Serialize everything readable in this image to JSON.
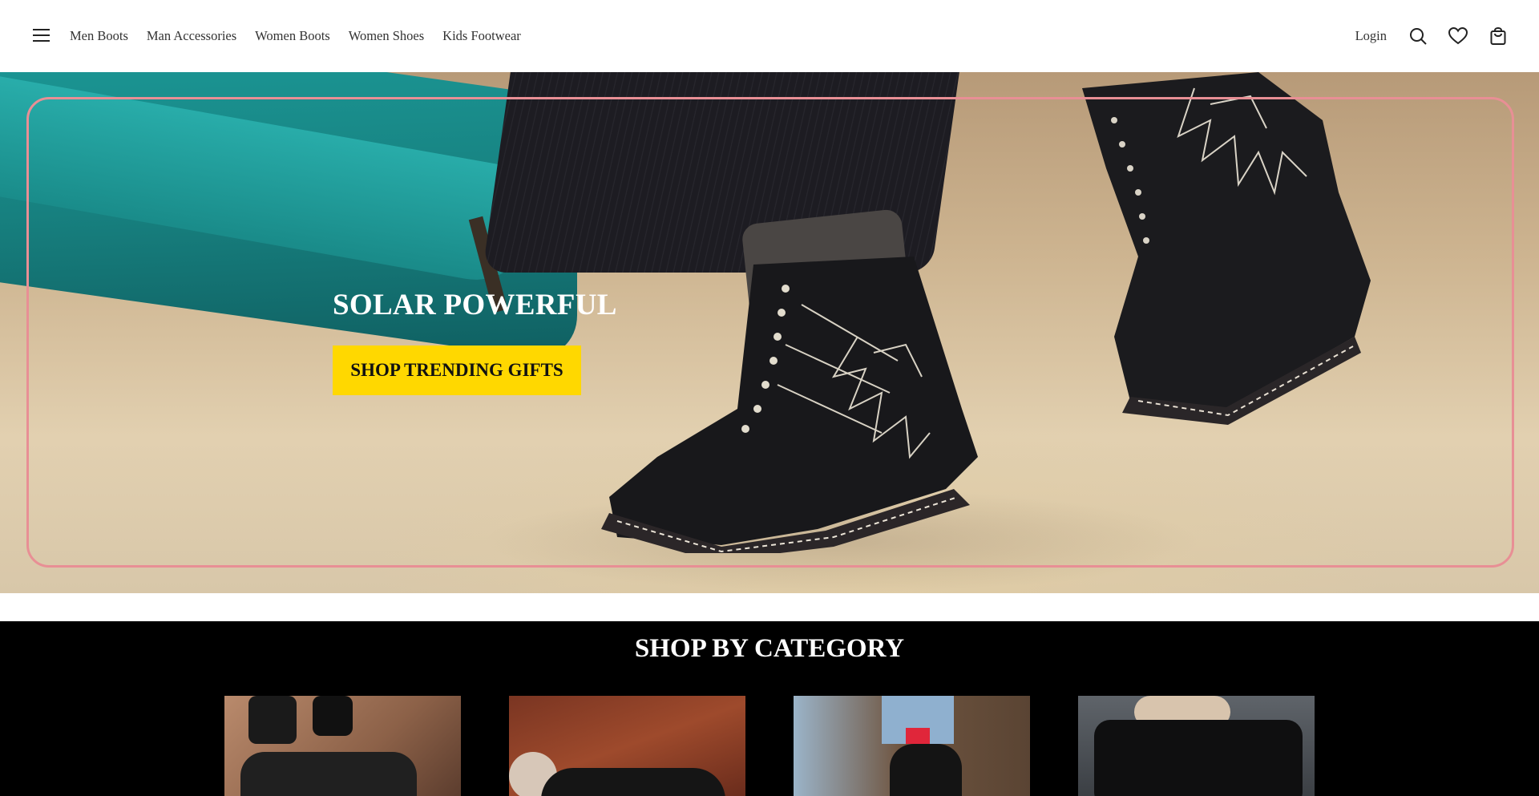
{
  "header": {
    "menu_icon": "hamburger-menu-icon",
    "nav": [
      {
        "label": "Men Boots"
      },
      {
        "label": "Man Accessories"
      },
      {
        "label": "Women Boots"
      },
      {
        "label": "Women Shoes"
      },
      {
        "label": "Kids Footwear"
      }
    ],
    "login_label": "Login",
    "icons": [
      "search-icon",
      "heart-icon",
      "shopping-bag-icon"
    ]
  },
  "hero": {
    "title": "SOLAR POWERFUL",
    "cta_label": "SHOP TRENDING GIFTS",
    "frame_color": "#e88f95",
    "cta_color": "#ffd800"
  },
  "category_section": {
    "title": "SHOP BY CATEGORY",
    "background": "#000000"
  }
}
